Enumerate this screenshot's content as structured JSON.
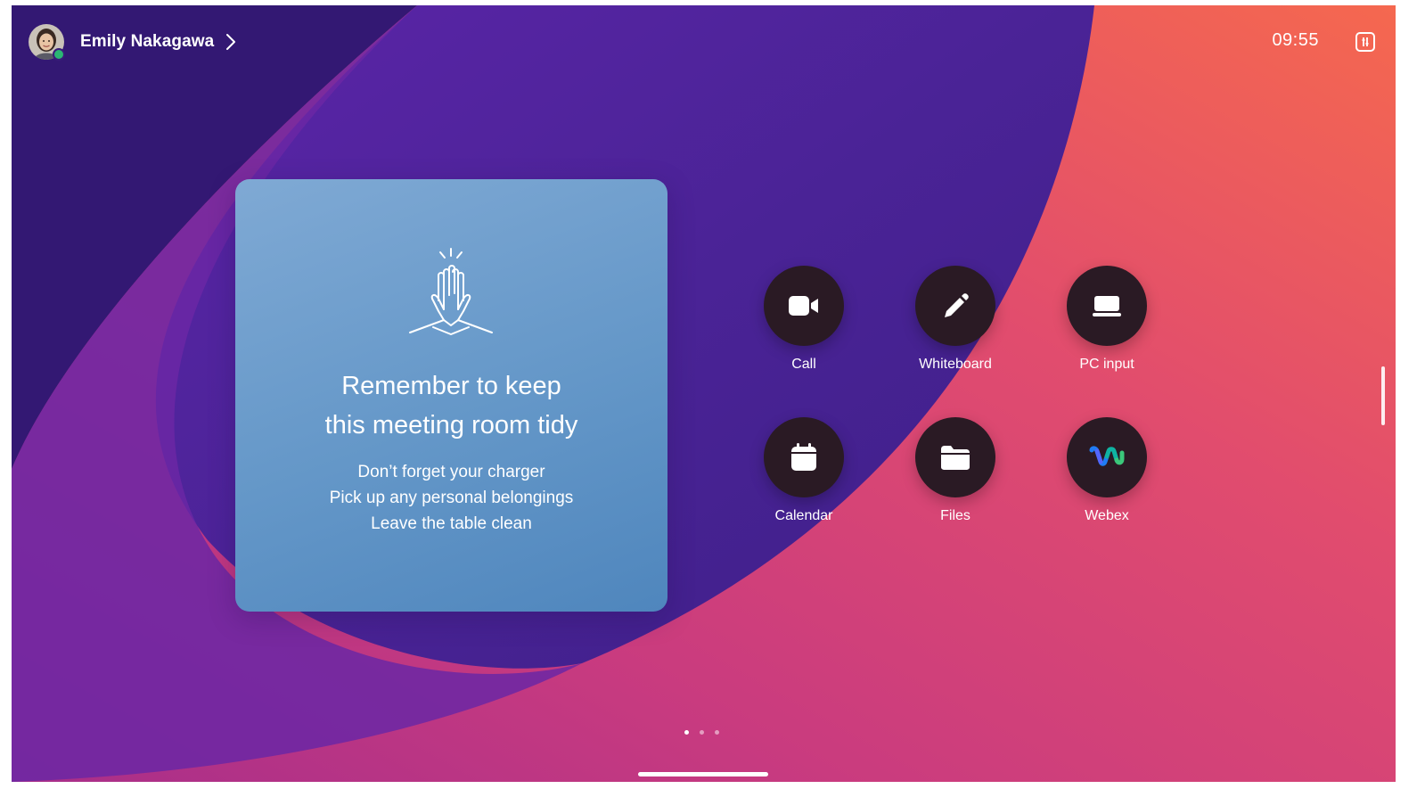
{
  "user": {
    "name": "Emily Nakagawa",
    "status": "available"
  },
  "clock": {
    "time": "09:55"
  },
  "card": {
    "title_line1": "Remember to keep",
    "title_line2": "this meeting room tidy",
    "lines": [
      "Don’t forget your charger",
      "Pick up any personal belongings",
      "Leave the table clean"
    ],
    "icon": "high-five-icon"
  },
  "apps": [
    {
      "label": "Call",
      "icon": "video-camera-icon"
    },
    {
      "label": "Whiteboard",
      "icon": "pencil-icon"
    },
    {
      "label": "PC input",
      "icon": "laptop-icon"
    },
    {
      "label": "Calendar",
      "icon": "calendar-icon"
    },
    {
      "label": "Files",
      "icon": "folder-icon"
    },
    {
      "label": "Webex",
      "icon": "webex-icon"
    }
  ],
  "pager": {
    "pages": 3,
    "current": 1
  },
  "colors": {
    "accent_presence": "#2bb673",
    "app_button": "#2a1a24",
    "card": "#6497c8"
  }
}
